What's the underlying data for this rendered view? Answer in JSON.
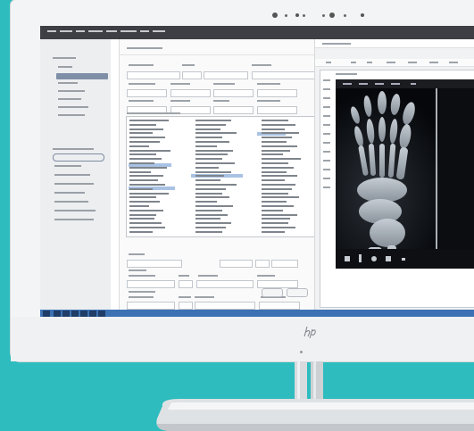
{
  "scene": {
    "subject": "hp-all-in-one-monitor",
    "brand_mark": "hp",
    "background_color": "#2ebcbf",
    "accent_color": "#3c72b4"
  },
  "screen": {
    "app_kind": "medical-records-form-with-xray-viewer",
    "xray_subject": "foot-xray",
    "taskbar_icon_count": 7
  }
}
